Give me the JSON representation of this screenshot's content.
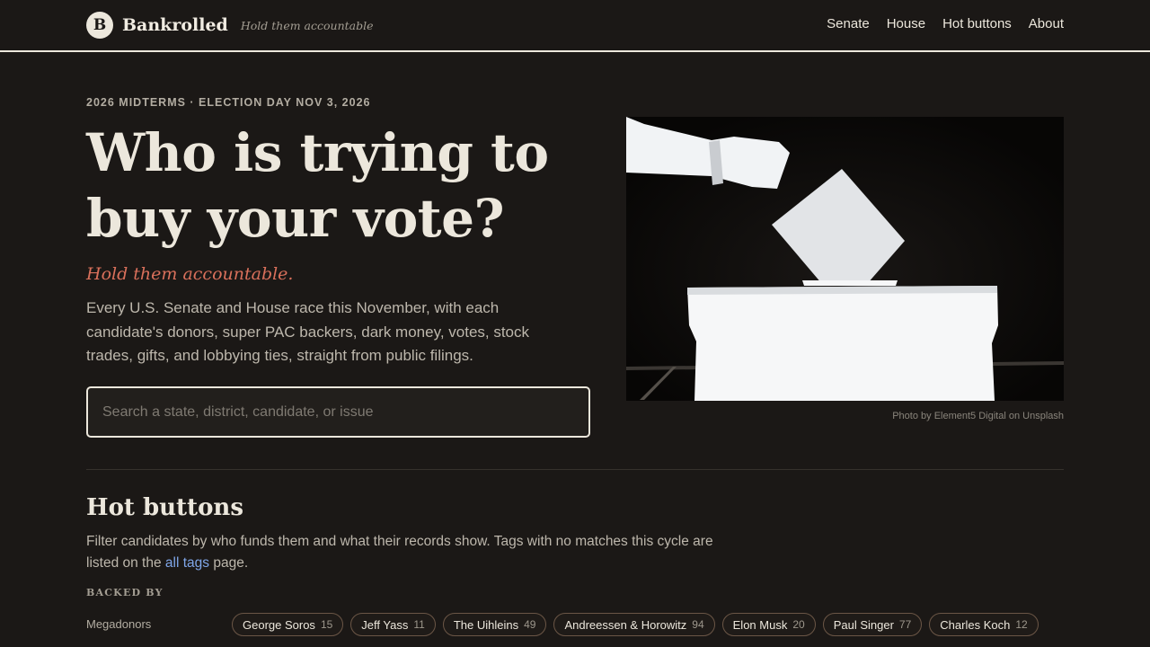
{
  "header": {
    "logo_letter": "B",
    "brand": "Bankrolled",
    "tagline": "Hold them accountable",
    "nav": [
      "Senate",
      "House",
      "Hot buttons",
      "About"
    ]
  },
  "hero": {
    "eyebrow": "2026 MIDTERMS · ELECTION DAY NOV 3, 2026",
    "headline": "Who is trying to buy your vote?",
    "tagline": "Hold them accountable.",
    "lede": "Every U.S. Senate and House race this November, with each candidate's donors, super PAC backers, dark money, votes, stock trades, gifts, and lobbying ties, straight from public filings.",
    "search_placeholder": "Search a state, district, candidate, or issue",
    "photo_credit": "Photo by Element5 Digital on Unsplash"
  },
  "hot_buttons": {
    "title": "Hot buttons",
    "desc_before": "Filter candidates by who funds them and what their records show. Tags with no matches this cycle are listed on the ",
    "desc_link": "all tags",
    "desc_after": " page.",
    "group_label": "BACKED BY",
    "rows": [
      {
        "label": "Megadonors",
        "chips": [
          {
            "name": "George Soros",
            "count": "15"
          },
          {
            "name": "Jeff Yass",
            "count": "11"
          },
          {
            "name": "The Uihleins",
            "count": "49"
          },
          {
            "name": "Andreessen & Horowitz",
            "count": "94"
          },
          {
            "name": "Elon Musk",
            "count": "20"
          },
          {
            "name": "Paul Singer",
            "count": "77"
          },
          {
            "name": "Charles Koch",
            "count": "12"
          }
        ]
      }
    ]
  },
  "colors": {
    "background": "#1b1816",
    "text": "#ece7dc",
    "accent": "#d9705b",
    "link": "#7fa6e8"
  }
}
